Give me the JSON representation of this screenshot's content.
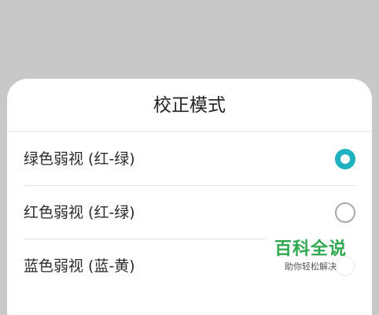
{
  "dialog": {
    "title": "校正模式",
    "options": [
      {
        "label": "绿色弱视 (红-绿)",
        "selected": true
      },
      {
        "label": "红色弱视 (红-绿)",
        "selected": false
      },
      {
        "label": "蓝色弱视 (蓝-黄)",
        "selected": false
      }
    ]
  },
  "watermark": {
    "title": "百科全说",
    "subtitle": "助你轻松解决"
  },
  "colors": {
    "accent": "#1eb2c0",
    "backdrop": "#c8c8c8",
    "watermark_green": "#2fa84f"
  }
}
